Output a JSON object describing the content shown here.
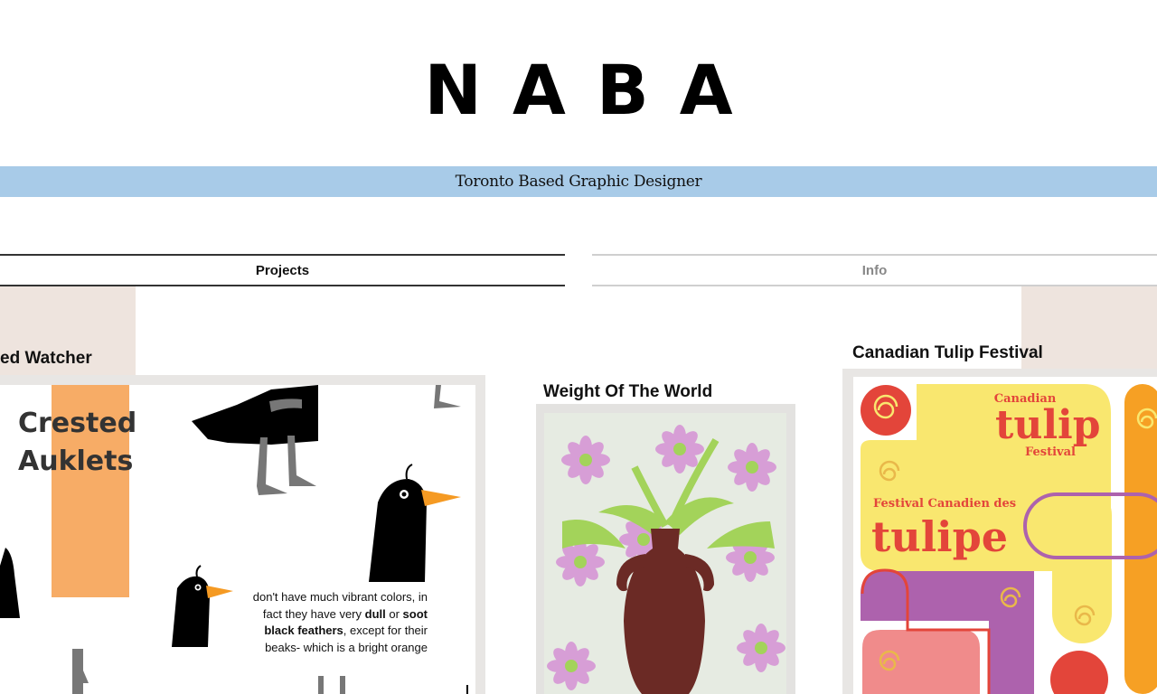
{
  "site": {
    "logo": "NABA",
    "tagline": "Toronto Based Graphic Designer"
  },
  "nav": {
    "projects": "Projects",
    "info": "Info"
  },
  "projects": [
    {
      "title": "ed Watcher",
      "poster": {
        "heading": "Crested\nAuklets",
        "text_parts": [
          "don't have much vibrant colors, in fact they have very ",
          "dull",
          " or ",
          "soot black feathers",
          ", except for their beaks- which is a bright orange"
        ]
      }
    },
    {
      "title": "Weight Of The World"
    },
    {
      "title": "Canadian Tulip Festival",
      "poster": {
        "canadian": "Canadian",
        "tulip": "tulip",
        "festival": "Festival",
        "festival_fr": "Festival Canadien des",
        "tulipe": "tulipe"
      }
    }
  ],
  "colors": {
    "tagline_bg": "#a8cbe8",
    "card_bg": "#eee4de",
    "auklet_orange": "#f7ac66",
    "tulip_yellow": "#f9e76f",
    "tulip_red": "#e3453a",
    "tulip_purple": "#ad62ad",
    "tulip_pink": "#f08b8b",
    "tulip_orange": "#f6a024",
    "vase_brown": "#6b2a25",
    "flower_lilac": "#d79ed6",
    "leaf_green": "#a3d35a"
  }
}
